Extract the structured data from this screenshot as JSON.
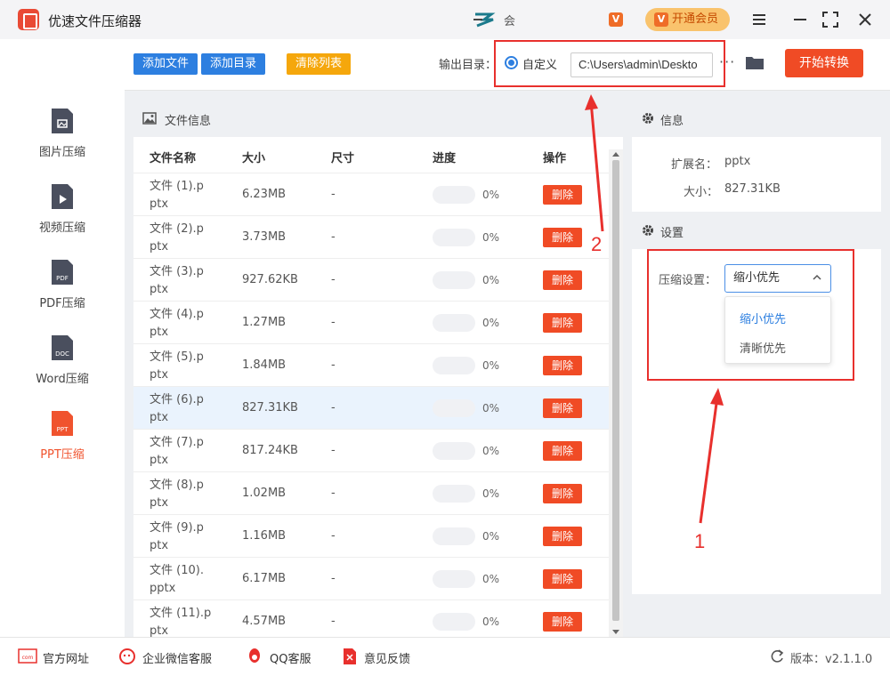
{
  "app": {
    "title": "优速文件压缩器",
    "user_name": "会",
    "vip_label": "开通会员",
    "vip_glyph": "V"
  },
  "sidebar": {
    "items": [
      {
        "label": "图片压缩",
        "icon": "image-file-icon",
        "tag": ""
      },
      {
        "label": "视频压缩",
        "icon": "video-file-icon",
        "tag": ""
      },
      {
        "label": "PDF压缩",
        "icon": "pdf-file-icon",
        "tag": "PDF"
      },
      {
        "label": "Word压缩",
        "icon": "doc-file-icon",
        "tag": "DOC"
      },
      {
        "label": "PPT压缩",
        "icon": "ppt-file-icon",
        "tag": "PPT",
        "active": true
      }
    ]
  },
  "toolbar": {
    "add_file": "添加文件",
    "add_dir": "添加目录",
    "clear_list": "清除列表",
    "output_label": "输出目录：",
    "radio_label": "自定义",
    "path_value": "C:\\Users\\admin\\Deskto",
    "more": "···",
    "start": "开始转换"
  },
  "file_panel": {
    "title": "文件信息",
    "columns": [
      "文件名称",
      "大小",
      "尺寸",
      "进度",
      "操作"
    ],
    "delete_label": "删除",
    "rows": [
      {
        "name1": "文件 (1).p",
        "name2": "ptx",
        "size": "6.23MB",
        "dim": "-",
        "pct": "0%"
      },
      {
        "name1": "文件 (2).p",
        "name2": "ptx",
        "size": "3.73MB",
        "dim": "-",
        "pct": "0%"
      },
      {
        "name1": "文件 (3).p",
        "name2": "ptx",
        "size": "927.62KB",
        "dim": "-",
        "pct": "0%"
      },
      {
        "name1": "文件 (4).p",
        "name2": "ptx",
        "size": "1.27MB",
        "dim": "-",
        "pct": "0%"
      },
      {
        "name1": "文件 (5).p",
        "name2": "ptx",
        "size": "1.84MB",
        "dim": "-",
        "pct": "0%"
      },
      {
        "name1": "文件 (6).p",
        "name2": "ptx",
        "size": "827.31KB",
        "dim": "-",
        "pct": "0%",
        "selected": true
      },
      {
        "name1": "文件 (7).p",
        "name2": "ptx",
        "size": "817.24KB",
        "dim": "-",
        "pct": "0%"
      },
      {
        "name1": "文件 (8).p",
        "name2": "ptx",
        "size": "1.02MB",
        "dim": "-",
        "pct": "0%"
      },
      {
        "name1": "文件 (9).p",
        "name2": "ptx",
        "size": "1.16MB",
        "dim": "-",
        "pct": "0%"
      },
      {
        "name1": "文件 (10).",
        "name2": "pptx",
        "size": "6.17MB",
        "dim": "-",
        "pct": "0%"
      },
      {
        "name1": "文件 (11).p",
        "name2": "ptx",
        "size": "4.57MB",
        "dim": "-",
        "pct": "0%"
      }
    ]
  },
  "info_panel": {
    "title": "信息",
    "ext_label": "扩展名：",
    "ext_value": "pptx",
    "size_label": "大小：",
    "size_value": "827.31KB",
    "settings_title": "设置",
    "compress_label": "压缩设置：",
    "compress_selected": "缩小优先",
    "options": [
      "缩小优先",
      "清晰优先"
    ]
  },
  "annotations": {
    "one": "1",
    "two": "2"
  },
  "footer": {
    "website": "官方网址",
    "wechat": "企业微信客服",
    "qq": "QQ客服",
    "feedback": "意见反馈",
    "version": "版本：v2.1.1.0",
    "com_tag": "com"
  },
  "colors": {
    "accent": "#f04b25",
    "blue": "#2d7fe0",
    "red_box": "#e8302d"
  }
}
